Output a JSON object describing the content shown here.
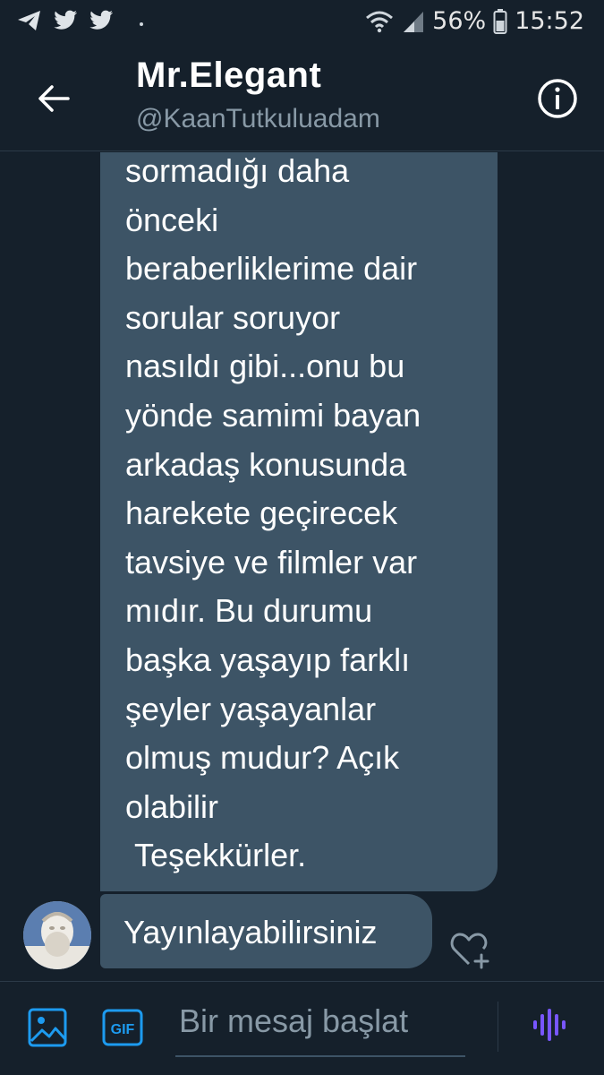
{
  "status_bar": {
    "icons": [
      "telegram-icon",
      "twitter-icon",
      "twitter-icon",
      "wifi-icon",
      "signal-icon",
      "battery-icon"
    ],
    "battery": "56%",
    "time": "15:52"
  },
  "header": {
    "title": "Mr.Elegant",
    "handle": "@KaanTutkuluadam",
    "back_icon": "arrow-left-icon",
    "info_icon": "info-icon"
  },
  "messages": [
    {
      "text": "sormadığı daha\nönceki\nberaberliklerime dair\nsorular soruyor\nnasıldı gibi...onu bu\nyönde samimi bayan\narkadaş konusunda\nharekete geçirecek\ntavsiye ve filmler var\nmıdır. Bu durumu\nbaşka yaşayıp farklı\nşeyler yaşayanlar\nolmuş mudur? Açık\nolabilir\n Teşekkürler."
    },
    {
      "text": "Yayınlayabilirsiniz"
    }
  ],
  "composer": {
    "placeholder": "Bir mesaj başlat",
    "gif_label": "GIF",
    "accent": "#1d9bf0",
    "voice_color": "#7856ff"
  },
  "colors": {
    "background": "#15202b",
    "bubble": "#3d5466",
    "secondary_text": "#8899a6"
  }
}
